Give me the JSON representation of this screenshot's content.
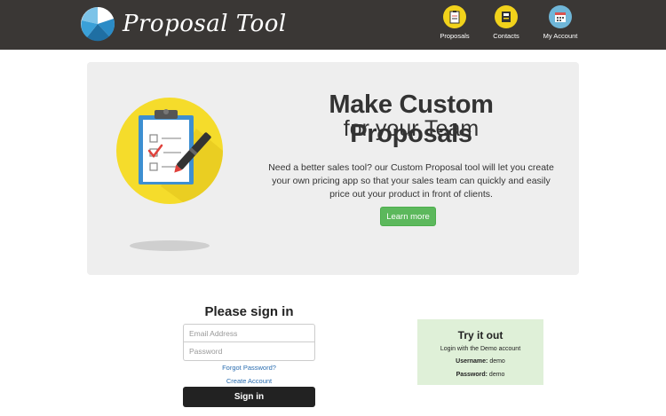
{
  "header": {
    "brand_name": "Proposal Tool",
    "background": "#3a3735",
    "nav": [
      {
        "label": "Proposals",
        "icon": "clipboard-icon",
        "color": "#f1d21b"
      },
      {
        "label": "Contacts",
        "icon": "contact-card-icon",
        "color": "#f1d21b"
      },
      {
        "label": "My Account",
        "icon": "calendar-icon",
        "color": "#6fb6d8"
      }
    ]
  },
  "hero": {
    "title": "Make Custom Proposals",
    "subtitle": "for your Team",
    "body": "Need a better sales tool? our Custom Proposal tool will let you create your own pricing app so that your sales team can quickly and easily price out your product in front of clients.",
    "button_label": "Learn more",
    "accent": "#5cb85c"
  },
  "signin": {
    "title": "Please sign in",
    "email_placeholder": "Email Address",
    "password_placeholder": "Password",
    "forgot_label": "Forgot Password?",
    "create_label": "Create Account",
    "button_label": "Sign in"
  },
  "demo": {
    "title": "Try it out",
    "line1": "Login with the Demo account",
    "username_label": "Username:",
    "username_value": "demo",
    "password_label": "Password:",
    "password_value": "demo"
  }
}
